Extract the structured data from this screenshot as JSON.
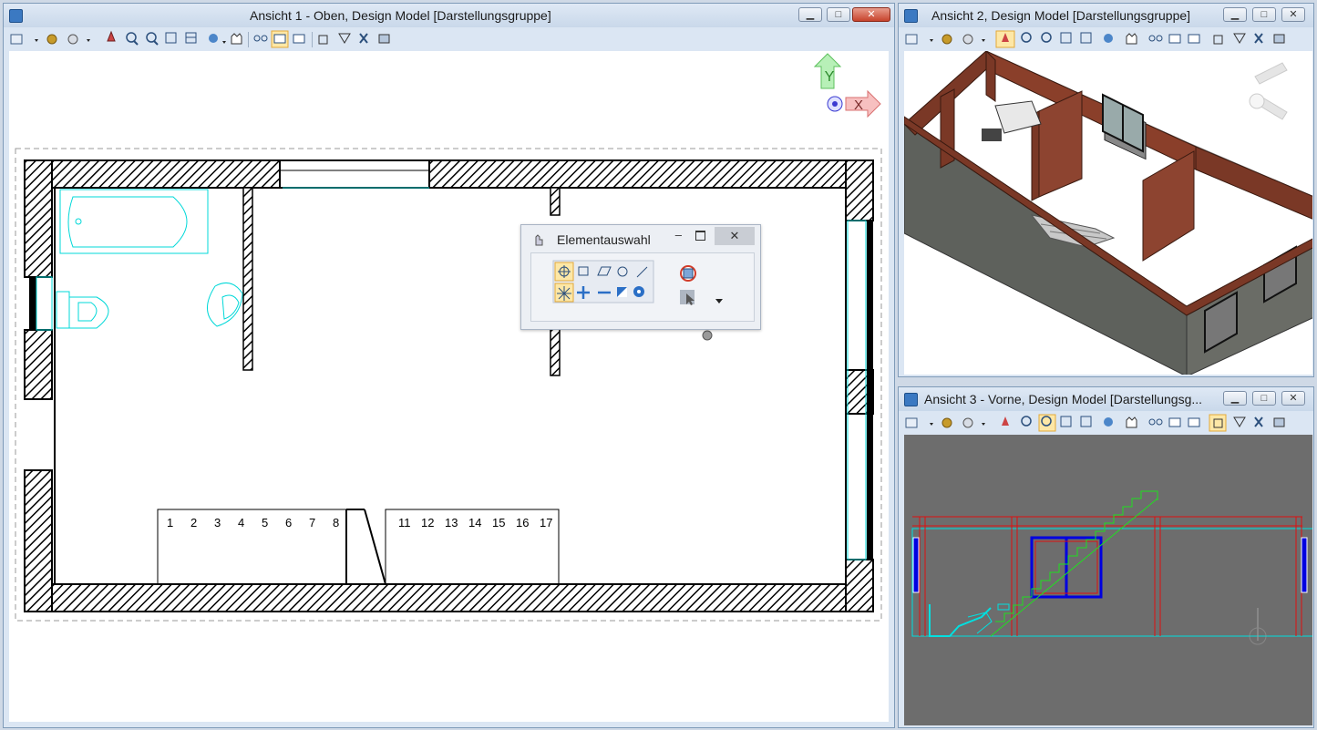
{
  "views": {
    "v1": {
      "title": "Ansicht 1 - Oben, Design Model [Darstellungsgruppe]"
    },
    "v2": {
      "title": "Ansicht 2, Design Model [Darstellungsgruppe]"
    },
    "v3": {
      "title": "Ansicht 3 - Vorne, Design Model [Darstellungsg..."
    }
  },
  "window_buttons": {
    "minimize": "▁",
    "maximize": "□",
    "close": "✕"
  },
  "axis": {
    "y": "Y",
    "x": "X"
  },
  "stairs": {
    "left": [
      "1",
      "2",
      "3",
      "4",
      "5",
      "6",
      "7",
      "8"
    ],
    "right": [
      "11",
      "12",
      "13",
      "14",
      "15",
      "16",
      "17"
    ]
  },
  "dialog": {
    "title": "Elementauswahl",
    "minimize": "–",
    "close": "✕",
    "tools_row1": [
      "selection-icon",
      "rectangle-icon",
      "parallelogram-icon",
      "circle-icon",
      "line-icon"
    ],
    "tools_row2": [
      "new-selection-icon",
      "add-icon",
      "subtract-icon",
      "invert-icon",
      "element-icon"
    ]
  },
  "colors": {
    "titlebar": "#c9d8ea",
    "toolbar": "#dbe6f3",
    "cad_white": "#ffffff",
    "cad_grey": "#6d6d6d",
    "cyan": "#00e0e0",
    "brick": "#7a3826"
  }
}
